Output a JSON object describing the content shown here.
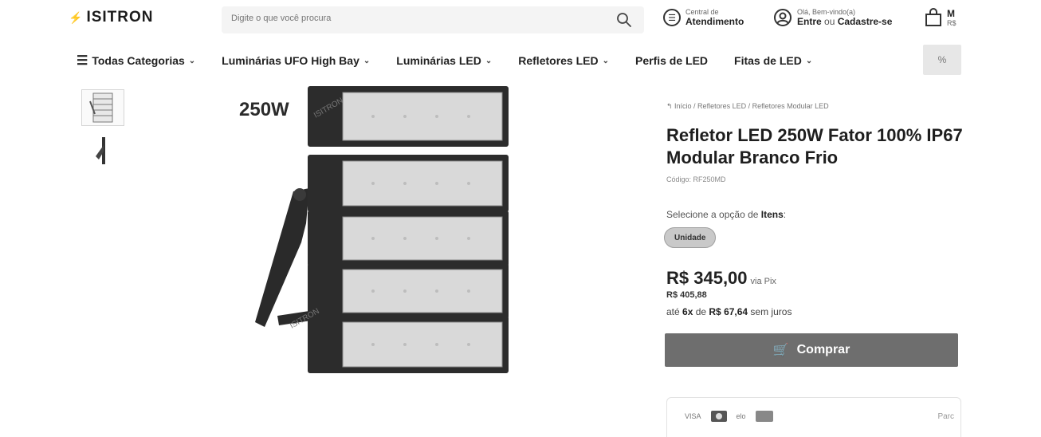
{
  "header": {
    "logo_text": "ISITRON",
    "search_placeholder": "Digite o que você procura",
    "support": {
      "line1": "Central de",
      "line2": "Atendimento"
    },
    "account": {
      "line1": "Olá, Bem-vindo(a)",
      "line2_a": "Entre",
      "line2_b": " ou ",
      "line2_c": "Cadastre-se"
    },
    "cart": {
      "line1": "M",
      "line2": "R$"
    }
  },
  "nav": {
    "items": [
      {
        "label": "Todas Categorias",
        "chevron": true
      },
      {
        "label": "Luminárias UFO High Bay",
        "chevron": true
      },
      {
        "label": "Luminárias LED",
        "chevron": true
      },
      {
        "label": "Refletores LED",
        "chevron": true
      },
      {
        "label": "Perfis de LED",
        "chevron": false
      },
      {
        "label": "Fitas de LED",
        "chevron": true
      }
    ],
    "extra_label": "%"
  },
  "product": {
    "image_label": "250W",
    "image_watermark": "ISITRON",
    "breadcrumb": "Início / Refletores LED / Refletores Modular LED",
    "title": "Refletor LED 250W Fator 100% IP67 Modular Branco Frio",
    "code": "Código: RF250MD",
    "option_prefix": "Selecione a opção de ",
    "option_name": "Itens",
    "option_suffix": ":",
    "option_value": "Unidade",
    "price": "R$ 345,00",
    "price_suffix": "via Pix",
    "old_price": "R$ 405,88",
    "install_prefix": "até ",
    "install_count": "6x",
    "install_mid": " de ",
    "install_value": "R$ 67,64",
    "install_suffix": " sem juros",
    "buy_label": "Comprar",
    "payment": {
      "visa": "VISA",
      "elo": "elo",
      "more": "Parc"
    }
  }
}
